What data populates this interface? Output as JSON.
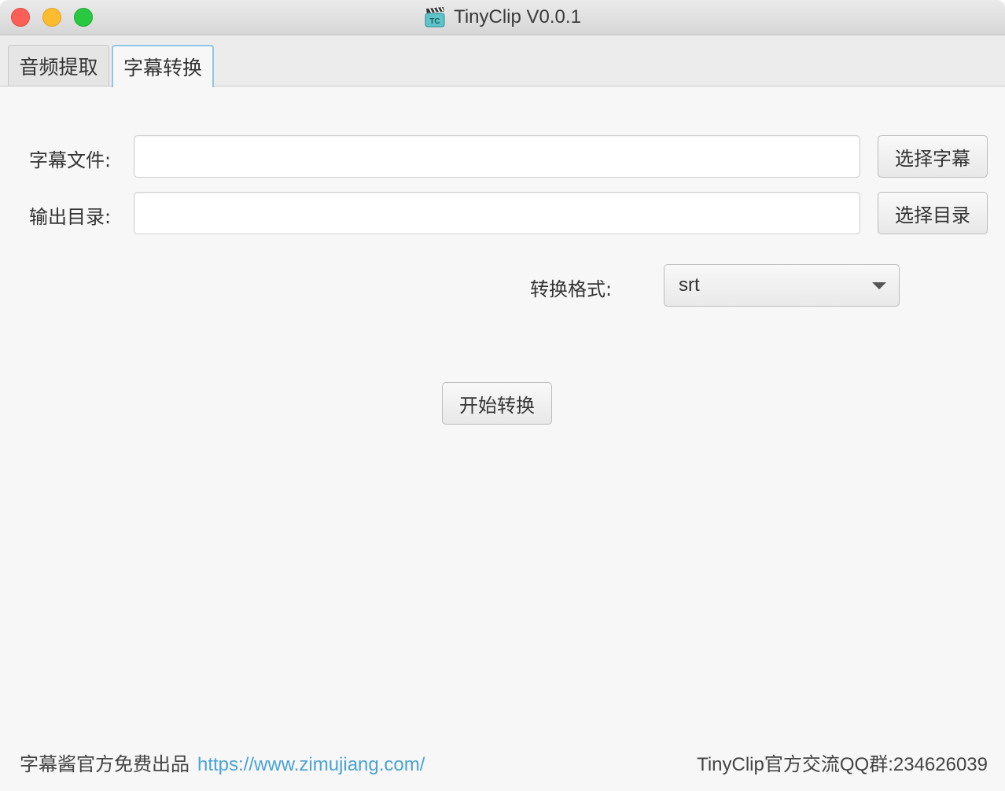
{
  "window": {
    "title": "TinyClip V0.0.1",
    "icon": "clapperboard-app-icon",
    "icon_text": "TC"
  },
  "tabs": [
    {
      "label": "音频提取",
      "active": false
    },
    {
      "label": "字幕转换",
      "active": true
    }
  ],
  "form": {
    "subtitle_file": {
      "label": "字幕文件:",
      "value": "",
      "button": "选择字幕"
    },
    "output_dir": {
      "label": "输出目录:",
      "value": "",
      "button": "选择目录"
    },
    "format": {
      "label": "转换格式:",
      "selected": "srt"
    },
    "start_button": "开始转换"
  },
  "footer": {
    "left_text": "字幕酱官方免费出品",
    "link": "https://www.zimujiang.com/",
    "right_text": "TinyClip官方交流QQ群:234626039"
  },
  "colors": {
    "active_tab_border": "#8fc6e8",
    "link": "#4aa3d6",
    "close": "#fc5f57",
    "minimize": "#fdbc2e",
    "maximize": "#28c840"
  }
}
